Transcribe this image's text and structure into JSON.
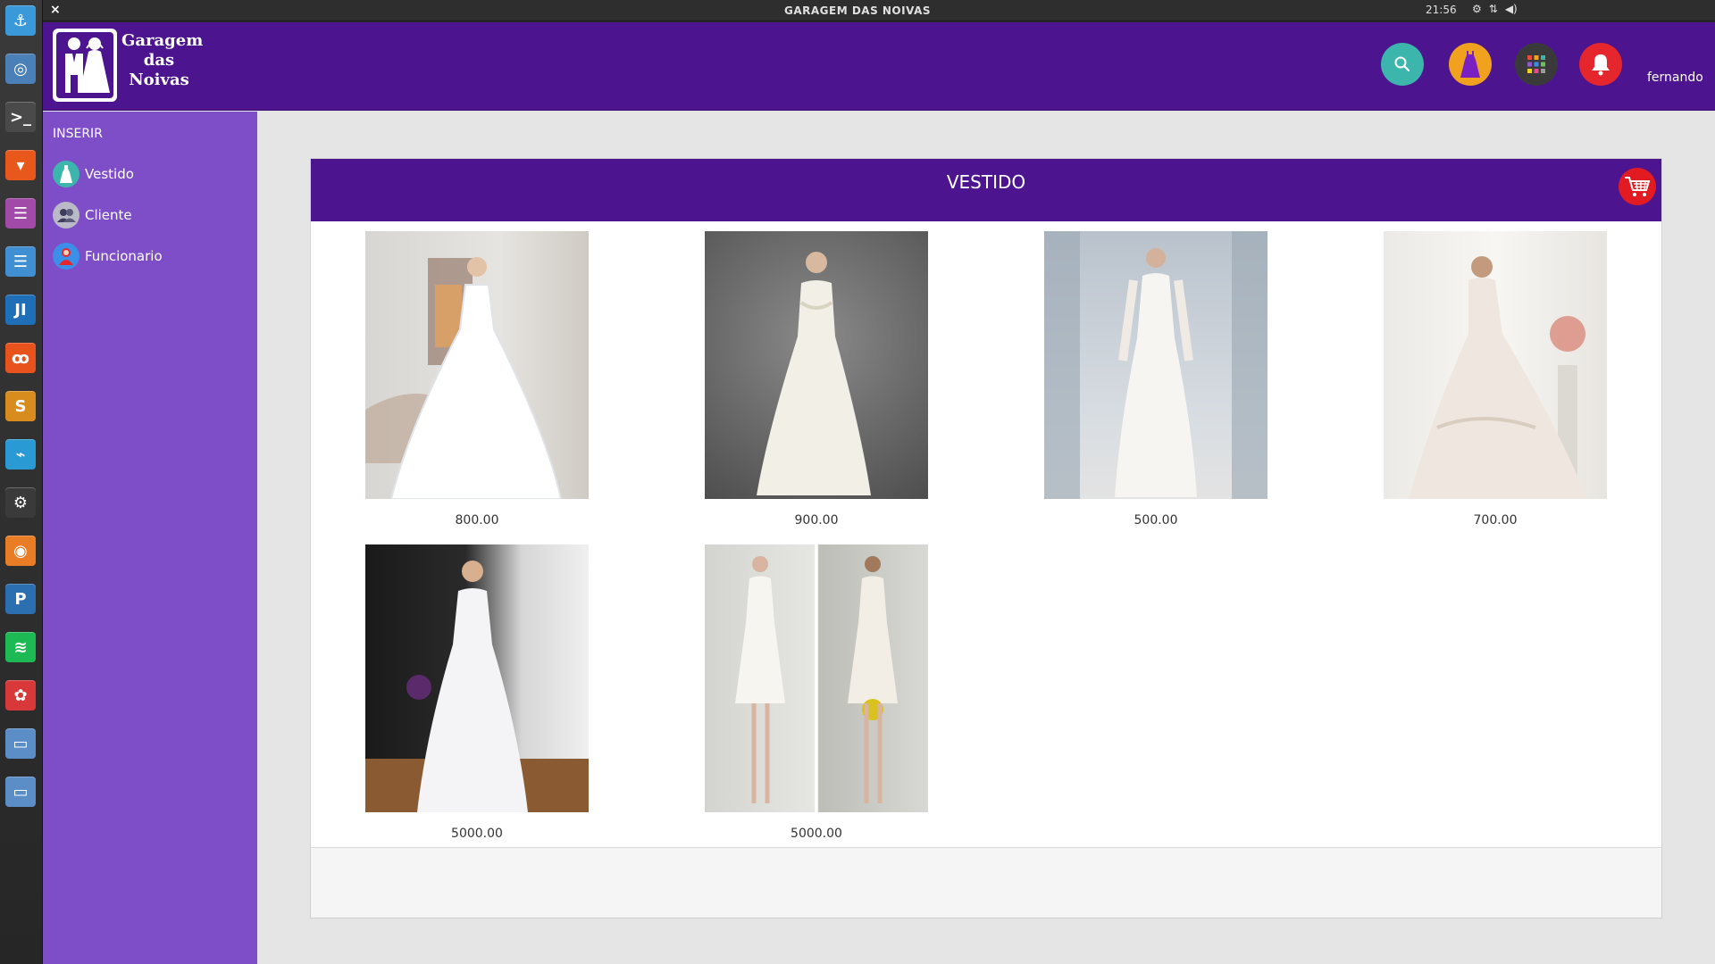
{
  "titlebar": {
    "title": "GARAGEM DAS NOIVAS",
    "clock": "21:56",
    "close": "×"
  },
  "launcher": [
    {
      "name": "anchor",
      "glyph": "⚓",
      "color": "#3a9ad9"
    },
    {
      "name": "chromium",
      "glyph": "◎",
      "color": "#4a7fb8"
    },
    {
      "name": "terminal",
      "glyph": ">_",
      "color": "#4a4a4a"
    },
    {
      "name": "presentation",
      "glyph": "▾",
      "color": "#e8571c"
    },
    {
      "name": "document",
      "glyph": "☰",
      "color": "#a14aa8"
    },
    {
      "name": "writer",
      "glyph": "☰",
      "color": "#3f8fd2"
    },
    {
      "name": "intellij",
      "glyph": "JI",
      "color": "#1e6fb8"
    },
    {
      "name": "xampp",
      "glyph": "ꝏ",
      "color": "#e8521c"
    },
    {
      "name": "sublime",
      "glyph": "S",
      "color": "#d98c1e"
    },
    {
      "name": "monitor",
      "glyph": "⌁",
      "color": "#2a9ad4"
    },
    {
      "name": "steam",
      "glyph": "⚙",
      "color": "#3a3a3a"
    },
    {
      "name": "blender",
      "glyph": "◉",
      "color": "#e87d26"
    },
    {
      "name": "pencil",
      "glyph": "P",
      "color": "#2b6fb0"
    },
    {
      "name": "spotify",
      "glyph": "≋",
      "color": "#1db954"
    },
    {
      "name": "game",
      "glyph": "✿",
      "color": "#d9383a"
    },
    {
      "name": "window-1",
      "glyph": "▭",
      "color": "#5b8ec7"
    },
    {
      "name": "window-2",
      "glyph": "▭",
      "color": "#5b8ec7"
    }
  ],
  "brand": {
    "name_line1": "Garagem",
    "name_line2": "das",
    "name_line3": "Noivas"
  },
  "user": {
    "name": "fernando"
  },
  "sidebar": {
    "section_label": "INSERIR",
    "items": [
      {
        "label": "Vestido",
        "icon": "dress-icon"
      },
      {
        "label": "Cliente",
        "icon": "clients-icon"
      },
      {
        "label": "Funcionario",
        "icon": "employee-icon"
      }
    ]
  },
  "panel": {
    "title": "VESTIDO"
  },
  "products": [
    {
      "price": "800.00"
    },
    {
      "price": "900.00"
    },
    {
      "price": "500.00"
    },
    {
      "price": "700.00"
    },
    {
      "price": "5000.00"
    },
    {
      "price": "5000.00"
    }
  ],
  "colors": {
    "brand_purple": "#4c158f",
    "sidebar_purple": "#7d4ec7",
    "cart_red": "#e21b23"
  }
}
